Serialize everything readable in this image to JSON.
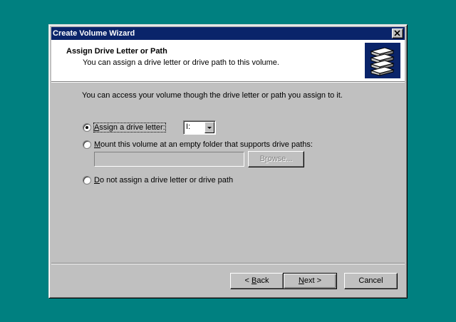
{
  "window": {
    "title": "Create Volume Wizard",
    "close_glyph": "×"
  },
  "header": {
    "title": "Assign Drive Letter or Path",
    "subtitle": "You can assign a drive letter or drive path to this volume."
  },
  "body": {
    "intro": "You can access your volume though the drive letter or path you assign to it."
  },
  "options": {
    "assign_letter": {
      "accel": "A",
      "rest": "ssign a drive letter:",
      "checked": true
    },
    "mount_folder": {
      "accel": "M",
      "rest": "ount this volume at an empty folder that supports drive paths:",
      "checked": false
    },
    "no_assign": {
      "accel": "D",
      "rest": "o not assign a drive letter or drive path",
      "checked": false
    }
  },
  "drive_letter": {
    "value": "I:"
  },
  "mount_path": {
    "value": ""
  },
  "browse_button": {
    "accel": "r",
    "pre": "B",
    "post": "owse..."
  },
  "footer": {
    "back": {
      "pre": "< ",
      "accel": "B",
      "post": "ack"
    },
    "next": {
      "accel": "N",
      "post": "ext >"
    },
    "cancel": "Cancel"
  }
}
